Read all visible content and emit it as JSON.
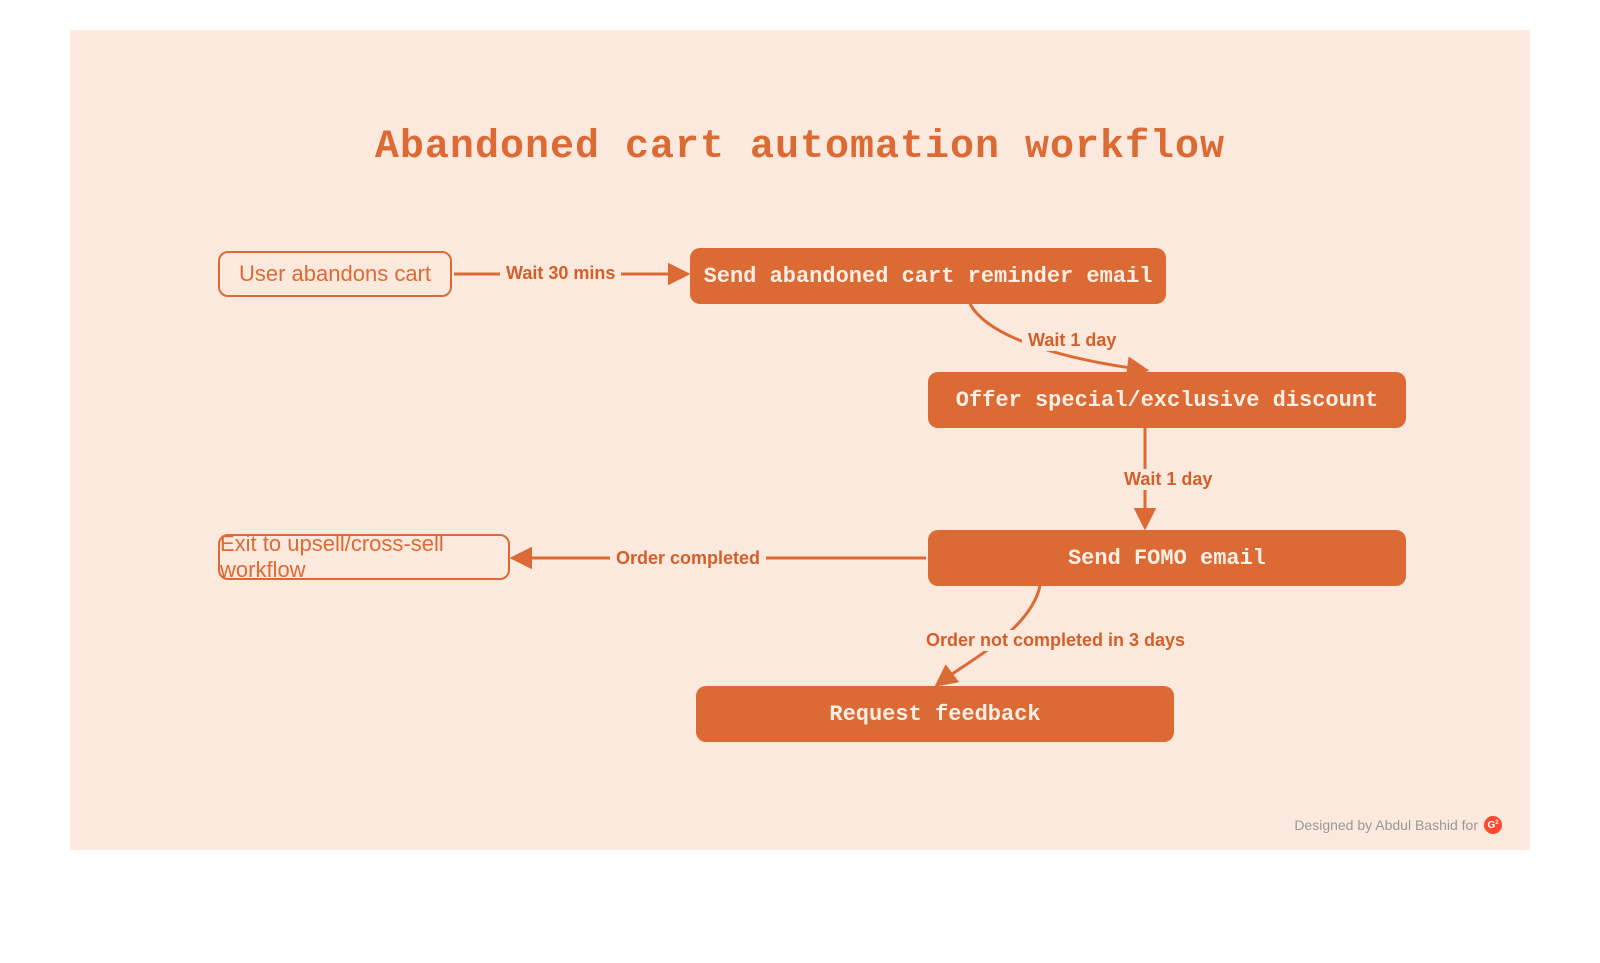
{
  "title": "Abandoned cart automation workflow",
  "nodes": {
    "start": {
      "label": "User abandons cart"
    },
    "reminder": {
      "label": "Send abandoned cart reminder email"
    },
    "discount": {
      "label": "Offer special/exclusive discount"
    },
    "fomo": {
      "label": "Send FOMO email"
    },
    "exit": {
      "label": "Exit to upsell/cross-sell workflow"
    },
    "feedback": {
      "label": "Request feedback"
    }
  },
  "edges": {
    "wait30": {
      "label": "Wait 30 mins"
    },
    "wait1a": {
      "label": "Wait 1 day"
    },
    "wait1b": {
      "label": "Wait 1 day"
    },
    "order_done": {
      "label": "Order completed"
    },
    "order_notdone": {
      "label": "Order not completed in 3 days"
    }
  },
  "colors": {
    "accent": "#DC6A34",
    "bg": "#FCE9DD"
  },
  "credit": {
    "text": "Designed by Abdul Bashid for",
    "brand": "G2"
  }
}
